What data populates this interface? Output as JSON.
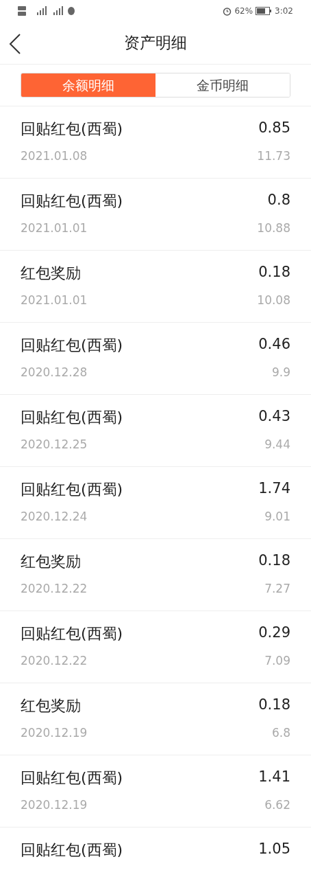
{
  "status_bar": {
    "battery": "62%",
    "time": "3:02"
  },
  "header": {
    "title": "资产明细"
  },
  "tabs": [
    {
      "label": "余额明细",
      "selected": true
    },
    {
      "label": "金币明细",
      "selected": false
    }
  ],
  "records": [
    {
      "title": "回贴红包(西蜀)",
      "amount": "0.85",
      "date": "2021.01.08",
      "balance": "11.73"
    },
    {
      "title": "回贴红包(西蜀)",
      "amount": "0.8",
      "date": "2021.01.01",
      "balance": "10.88"
    },
    {
      "title": "红包奖励",
      "amount": "0.18",
      "date": "2021.01.01",
      "balance": "10.08"
    },
    {
      "title": "回贴红包(西蜀)",
      "amount": "0.46",
      "date": "2020.12.28",
      "balance": "9.9"
    },
    {
      "title": "回贴红包(西蜀)",
      "amount": "0.43",
      "date": "2020.12.25",
      "balance": "9.44"
    },
    {
      "title": "回贴红包(西蜀)",
      "amount": "1.74",
      "date": "2020.12.24",
      "balance": "9.01"
    },
    {
      "title": "红包奖励",
      "amount": "0.18",
      "date": "2020.12.22",
      "balance": "7.27"
    },
    {
      "title": "回贴红包(西蜀)",
      "amount": "0.29",
      "date": "2020.12.22",
      "balance": "7.09"
    },
    {
      "title": "红包奖励",
      "amount": "0.18",
      "date": "2020.12.19",
      "balance": "6.8"
    },
    {
      "title": "回贴红包(西蜀)",
      "amount": "1.41",
      "date": "2020.12.19",
      "balance": "6.62"
    },
    {
      "title": "回贴红包(西蜀)",
      "amount": "1.05"
    }
  ]
}
